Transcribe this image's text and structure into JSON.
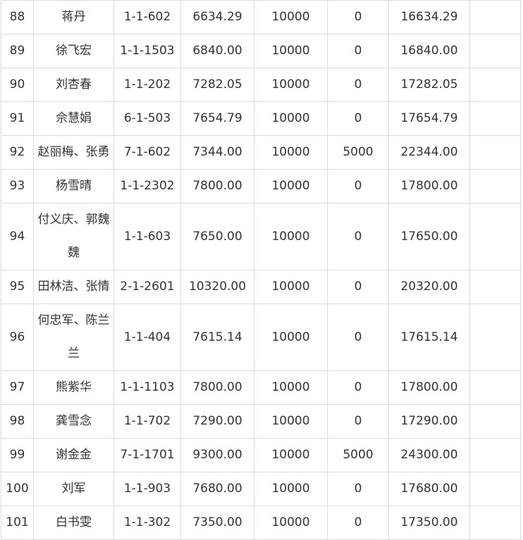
{
  "rows": [
    {
      "no": "88",
      "name": "蒋丹",
      "unit": "1-1-602",
      "a": "6634.29",
      "b": "10000",
      "c": "0",
      "total": "16634.29"
    },
    {
      "no": "89",
      "name": "徐飞宏",
      "unit": "1-1-1503",
      "a": "6840.00",
      "b": "10000",
      "c": "0",
      "total": "16840.00"
    },
    {
      "no": "90",
      "name": "刘杏春",
      "unit": "1-1-202",
      "a": "7282.05",
      "b": "10000",
      "c": "0",
      "total": "17282.05"
    },
    {
      "no": "91",
      "name": "佘慧娟",
      "unit": "6-1-503",
      "a": "7654.79",
      "b": "10000",
      "c": "0",
      "total": "17654.79"
    },
    {
      "no": "92",
      "name": "赵丽梅、张勇",
      "unit": "7-1-602",
      "a": "7344.00",
      "b": "10000",
      "c": "5000",
      "total": "22344.00"
    },
    {
      "no": "93",
      "name": "杨雪晴",
      "unit": "1-1-2302",
      "a": "7800.00",
      "b": "10000",
      "c": "0",
      "total": "17800.00"
    },
    {
      "no": "94",
      "name": "付义庆、郭魏魏",
      "unit": "1-1-603",
      "a": "7650.00",
      "b": "10000",
      "c": "0",
      "total": "17650.00"
    },
    {
      "no": "95",
      "name": "田林洁、张情",
      "unit": "2-1-2601",
      "a": "10320.00",
      "b": "10000",
      "c": "0",
      "total": "20320.00"
    },
    {
      "no": "96",
      "name": "何忠军、陈兰兰",
      "unit": "1-1-404",
      "a": "7615.14",
      "b": "10000",
      "c": "0",
      "total": "17615.14"
    },
    {
      "no": "97",
      "name": "熊紫华",
      "unit": "1-1-1103",
      "a": "7800.00",
      "b": "10000",
      "c": "0",
      "total": "17800.00"
    },
    {
      "no": "98",
      "name": "龚雪念",
      "unit": "1-1-702",
      "a": "7290.00",
      "b": "10000",
      "c": "0",
      "total": "17290.00"
    },
    {
      "no": "99",
      "name": "谢金金",
      "unit": "7-1-1701",
      "a": "9300.00",
      "b": "10000",
      "c": "5000",
      "total": "24300.00"
    },
    {
      "no": "100",
      "name": "刘军",
      "unit": "1-1-903",
      "a": "7680.00",
      "b": "10000",
      "c": "0",
      "total": "17680.00"
    },
    {
      "no": "101",
      "name": "白书雯",
      "unit": "1-1-302",
      "a": "7350.00",
      "b": "10000",
      "c": "0",
      "total": "17350.00"
    }
  ]
}
